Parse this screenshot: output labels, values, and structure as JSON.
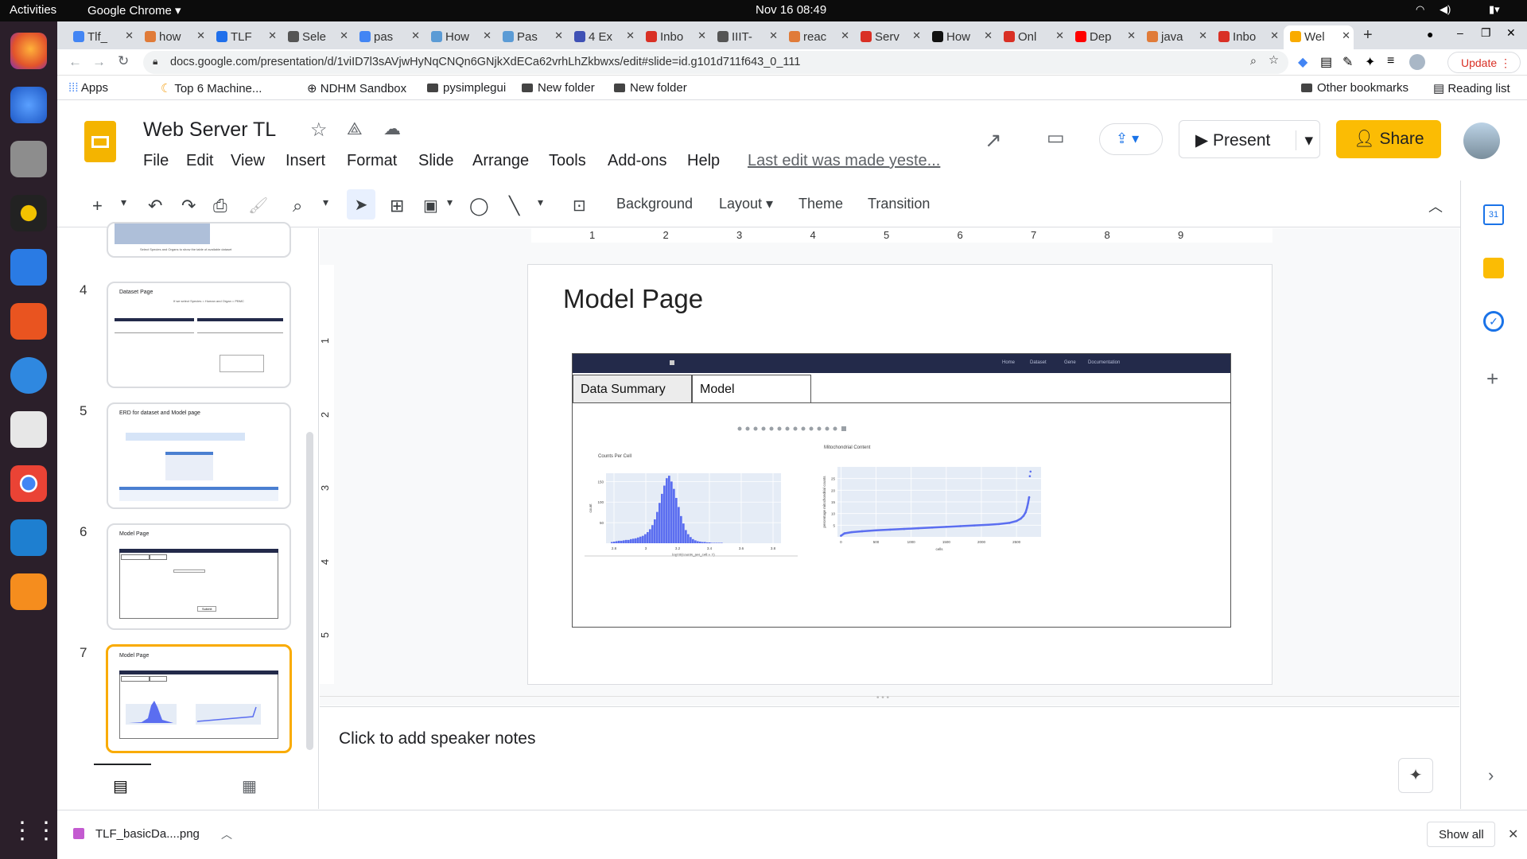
{
  "system": {
    "activities": "Activities",
    "app": "Google Chrome",
    "clock": "Nov 16  08:49"
  },
  "tabs": [
    {
      "label": "Tlf_",
      "color": "#4285f4"
    },
    {
      "label": "how",
      "color": "#e07b39"
    },
    {
      "label": "TLF",
      "color": "#1f6feb"
    },
    {
      "label": "Sele",
      "color": "#555555"
    },
    {
      "label": "pas",
      "color": "#4285f4"
    },
    {
      "label": "How",
      "color": "#5b9bd5"
    },
    {
      "label": "Pas",
      "color": "#5b9bd5"
    },
    {
      "label": "4 Ex",
      "color": "#3f51b5"
    },
    {
      "label": "Inbo",
      "color": "#d93025"
    },
    {
      "label": "IIIT-",
      "color": "#555555"
    },
    {
      "label": "reac",
      "color": "#e07b39"
    },
    {
      "label": "Serv",
      "color": "#d93025"
    },
    {
      "label": "How",
      "color": "#111111"
    },
    {
      "label": "Onl",
      "color": "#d93025"
    },
    {
      "label": "Dep",
      "color": "#ff0000"
    },
    {
      "label": "java",
      "color": "#e07b39"
    },
    {
      "label": "Inbo",
      "color": "#d93025"
    },
    {
      "label": "Wel",
      "color": "#f9ab00"
    }
  ],
  "address": {
    "url": "docs.google.com/presentation/d/1viID7l3sAVjwHyNqCNQn6GNjkXdECa62vrhLhZkbwxs/edit#slide=id.g101d711f643_0_111",
    "update_label": "Update"
  },
  "bookmarks": [
    "Apps",
    "Top 6 Machine...",
    "NDHM Sandbox",
    "pysimplegui",
    "New folder",
    "New folder"
  ],
  "bookmarks_right": [
    "Other bookmarks",
    "Reading list"
  ],
  "docs": {
    "title": "Web Server TL",
    "menus": [
      "File",
      "Edit",
      "View",
      "Insert",
      "Format",
      "Slide",
      "Arrange",
      "Tools",
      "Add-ons",
      "Help"
    ],
    "last_edit": "Last edit was made yeste...",
    "present_label": "Present",
    "share_label": "Share"
  },
  "toolbar": {
    "background": "Background",
    "layout": "Layout",
    "theme": "Theme",
    "transition": "Transition"
  },
  "ruler": {
    "h_marks": [
      "1",
      "2",
      "3",
      "4",
      "5",
      "6",
      "7",
      "8",
      "9"
    ],
    "v_marks": [
      "1",
      "2",
      "3",
      "4",
      "5"
    ]
  },
  "thumbnails": [
    {
      "num": "",
      "title": "",
      "caption": "Select Species and Organs to show the table of available dataset"
    },
    {
      "num": "4",
      "title": "Dataset Page",
      "caption": "If we select Species = Human and Organ = PBMC"
    },
    {
      "num": "5",
      "title": "ERD for dataset and Model page",
      "caption": ""
    },
    {
      "num": "6",
      "title": "Model Page",
      "caption": "Submit"
    },
    {
      "num": "7",
      "title": "Model Page",
      "caption": ""
    }
  ],
  "slide": {
    "title": "Model Page",
    "nav_links": [
      "Home",
      "Dataset",
      "Gene",
      "Documentation"
    ],
    "tab_summary": "Data Summary",
    "tab_model": "Model",
    "chart1_title": "Counts Per Cell",
    "chart2_title": "Mitochondrial Content"
  },
  "chart_data": [
    {
      "type": "bar",
      "title": "Counts Per Cell",
      "xlabel": "log10(counts_per_cell + 1)",
      "ylabel": "count",
      "x_ticks": [
        "2.8",
        "3",
        "3.2",
        "3.4",
        "3.6",
        "3.8"
      ],
      "y_ticks": [
        "50",
        "100",
        "150"
      ],
      "xlim": [
        2.75,
        3.85
      ],
      "ylim": [
        0,
        170
      ],
      "bins_start": 2.78,
      "bin_width": 0.015,
      "values": [
        3,
        4,
        5,
        6,
        6,
        7,
        8,
        8,
        10,
        11,
        12,
        14,
        16,
        18,
        22,
        27,
        34,
        44,
        58,
        76,
        98,
        120,
        140,
        158,
        164,
        150,
        132,
        110,
        88,
        66,
        48,
        32,
        22,
        15,
        10,
        7,
        5,
        4,
        3,
        3,
        2,
        2,
        1,
        1,
        1,
        1,
        1
      ],
      "color": "#5b6ef0",
      "grid": true
    },
    {
      "type": "scatter",
      "title": "Mitochondrial Content",
      "xlabel": "cells",
      "ylabel": "percentage mitochondrial counts",
      "x_ticks": [
        "0",
        "500",
        "1000",
        "1500",
        "2000",
        "2500"
      ],
      "y_ticks": [
        "5",
        "10",
        "15",
        "20",
        "25"
      ],
      "xlim": [
        -50,
        2850
      ],
      "ylim": [
        0,
        30
      ],
      "points": [
        [
          0,
          0.5
        ],
        [
          50,
          1.5
        ],
        [
          150,
          2
        ],
        [
          300,
          2.4
        ],
        [
          500,
          2.8
        ],
        [
          700,
          3.1
        ],
        [
          900,
          3.4
        ],
        [
          1100,
          3.7
        ],
        [
          1300,
          4.0
        ],
        [
          1500,
          4.3
        ],
        [
          1700,
          4.6
        ],
        [
          1900,
          4.9
        ],
        [
          2100,
          5.2
        ],
        [
          2250,
          5.5
        ],
        [
          2400,
          6.0
        ],
        [
          2500,
          6.8
        ],
        [
          2560,
          7.8
        ],
        [
          2600,
          9
        ],
        [
          2630,
          10.5
        ],
        [
          2650,
          12.5
        ],
        [
          2665,
          14.5
        ],
        [
          2680,
          17
        ],
        [
          2690,
          26
        ],
        [
          2700,
          28
        ]
      ],
      "color": "#5b6ef0",
      "grid": true
    }
  ],
  "notes": {
    "placeholder": "Click to add speaker notes"
  },
  "download": {
    "file": "TLF_basicDa....png",
    "show_all": "Show all"
  }
}
